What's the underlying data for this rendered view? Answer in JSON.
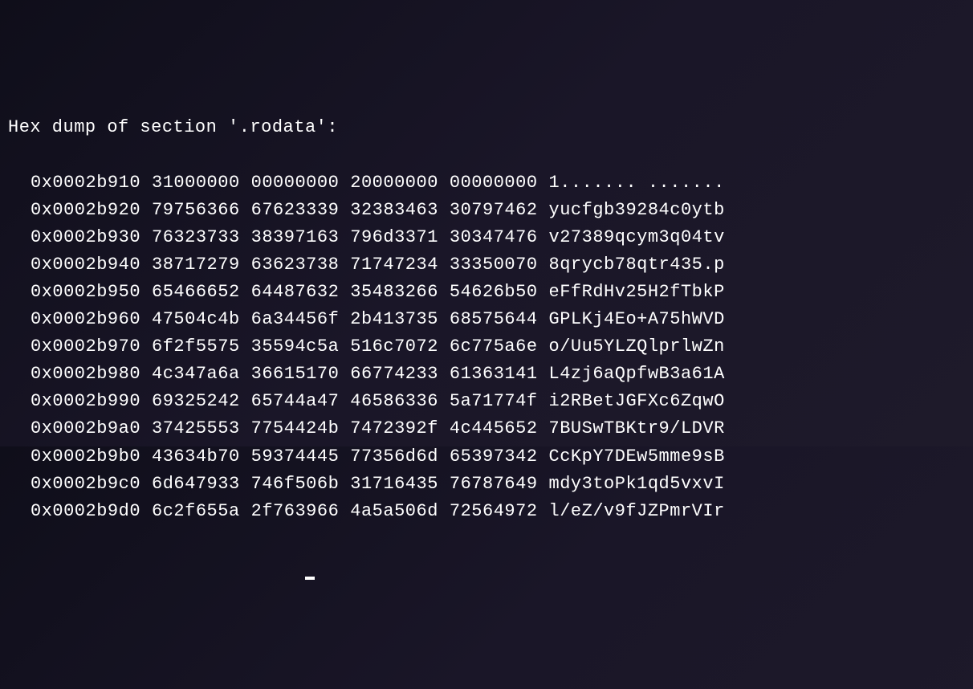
{
  "header": "Hex dump of section '.rodata':",
  "rows": [
    {
      "addr": "0x0002b910",
      "h0": "31000000",
      "h1": "00000000",
      "h2": "20000000",
      "h3": "00000000",
      "ascii": "1....... ......."
    },
    {
      "addr": "0x0002b920",
      "h0": "79756366",
      "h1": "67623339",
      "h2": "32383463",
      "h3": "30797462",
      "ascii": "yucfgb39284c0ytb"
    },
    {
      "addr": "0x0002b930",
      "h0": "76323733",
      "h1": "38397163",
      "h2": "796d3371",
      "h3": "30347476",
      "ascii": "v27389qcym3q04tv"
    },
    {
      "addr": "0x0002b940",
      "h0": "38717279",
      "h1": "63623738",
      "h2": "71747234",
      "h3": "33350070",
      "ascii": "8qrycb78qtr435.p"
    },
    {
      "addr": "0x0002b950",
      "h0": "65466652",
      "h1": "64487632",
      "h2": "35483266",
      "h3": "54626b50",
      "ascii": "eFfRdHv25H2fTbkP"
    },
    {
      "addr": "0x0002b960",
      "h0": "47504c4b",
      "h1": "6a34456f",
      "h2": "2b413735",
      "h3": "68575644",
      "ascii": "GPLKj4Eo+A75hWVD"
    },
    {
      "addr": "0x0002b970",
      "h0": "6f2f5575",
      "h1": "35594c5a",
      "h2": "516c7072",
      "h3": "6c775a6e",
      "ascii": "o/Uu5YLZQlprlwZn"
    },
    {
      "addr": "0x0002b980",
      "h0": "4c347a6a",
      "h1": "36615170",
      "h2": "66774233",
      "h3": "61363141",
      "ascii": "L4zj6aQpfwB3a61A"
    },
    {
      "addr": "0x0002b990",
      "h0": "69325242",
      "h1": "65744a47",
      "h2": "46586336",
      "h3": "5a71774f",
      "ascii": "i2RBetJGFXc6ZqwO"
    },
    {
      "addr": "0x0002b9a0",
      "h0": "37425553",
      "h1": "7754424b",
      "h2": "7472392f",
      "h3": "4c445652",
      "ascii": "7BUSwTBKtr9/LDVR"
    },
    {
      "addr": "0x0002b9b0",
      "h0": "43634b70",
      "h1": "59374445",
      "h2": "77356d6d",
      "h3": "65397342",
      "ascii": "CcKpY7DEw5mme9sB"
    },
    {
      "addr": "0x0002b9c0",
      "h0": "6d647933",
      "h1": "746f506b",
      "h2": "31716435",
      "h3": "76787649",
      "ascii": "mdy3toPk1qd5vxvI"
    },
    {
      "addr": "0x0002b9d0",
      "h0": "6c2f655a",
      "h1": "2f763966",
      "h2": "4a5a506d",
      "h3": "72564972",
      "ascii": "l/eZ/v9fJZPmrVIr"
    }
  ]
}
